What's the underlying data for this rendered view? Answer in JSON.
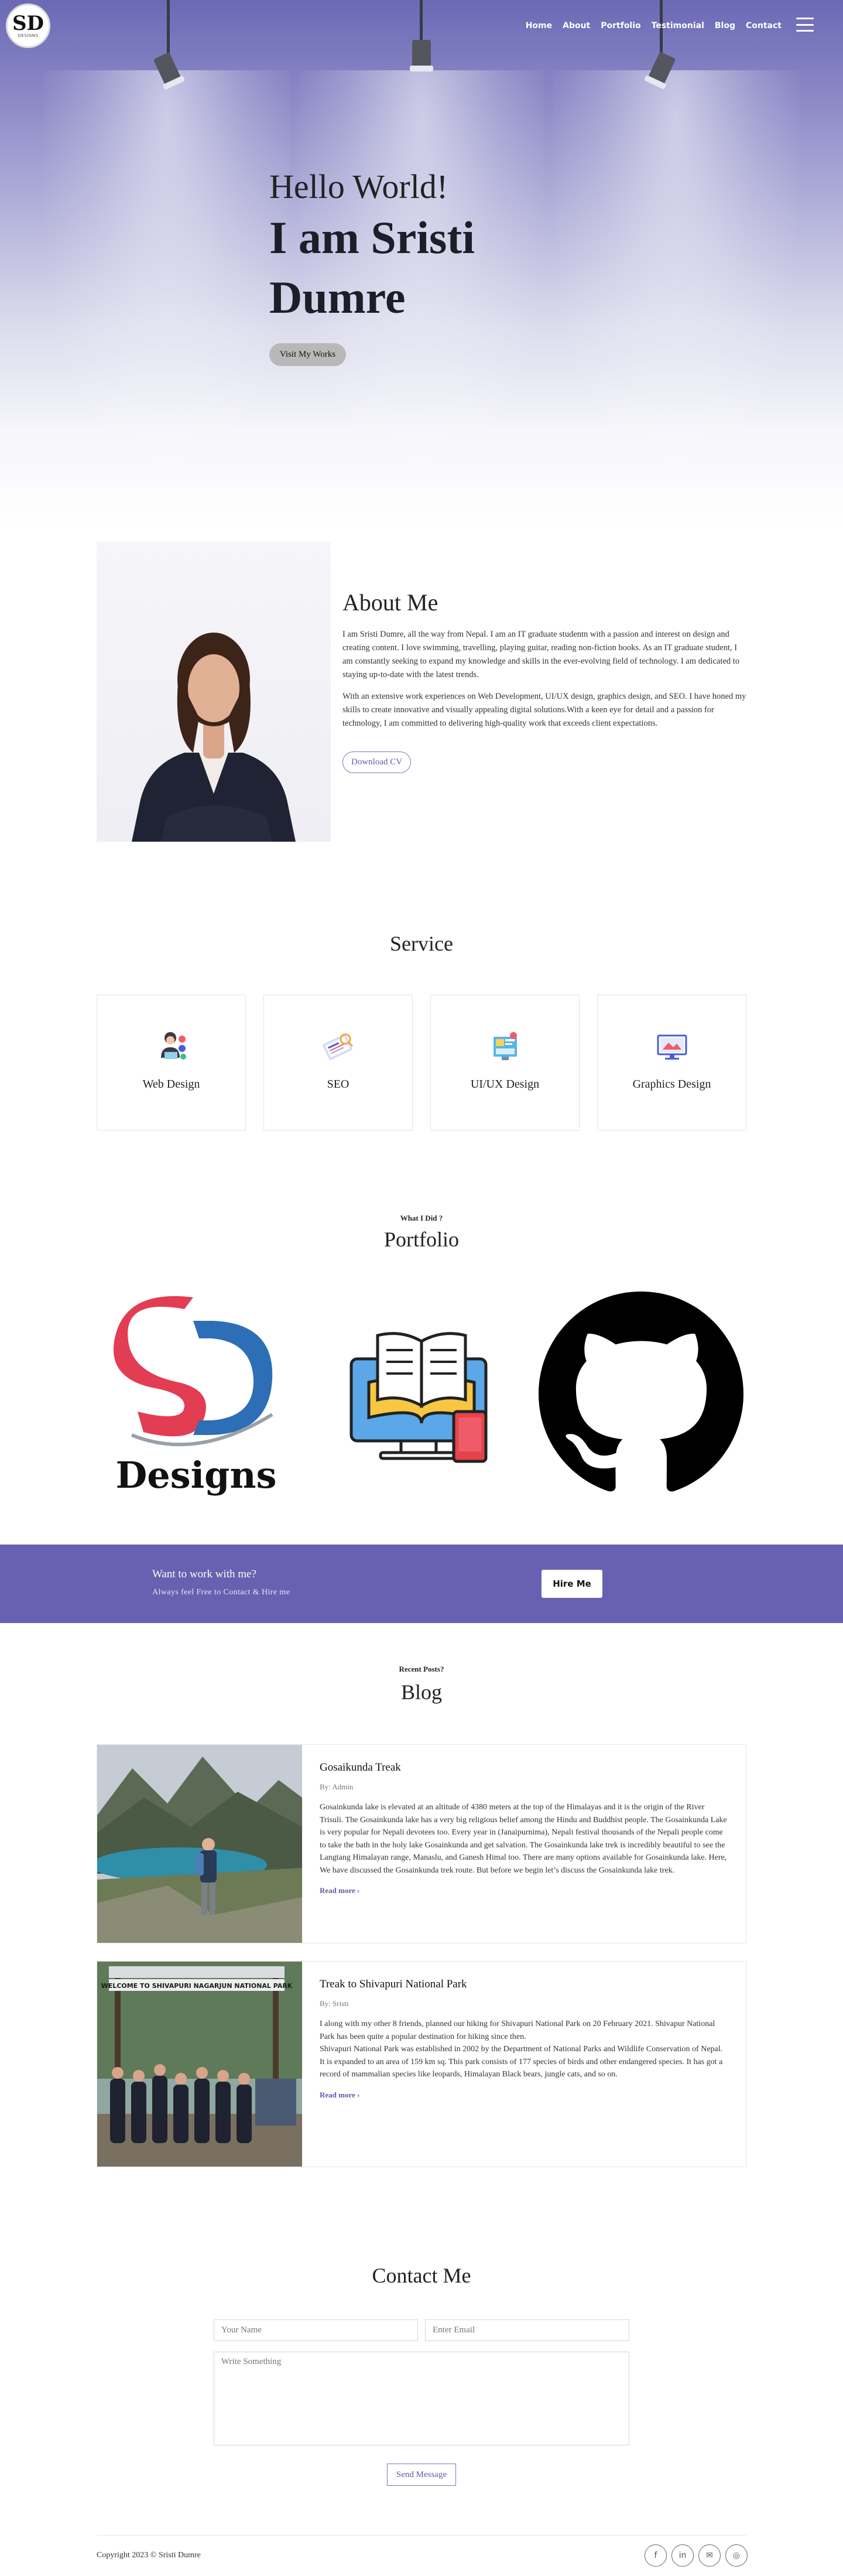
{
  "header": {
    "logo_main": "SD",
    "logo_sub": "DESIGNS",
    "nav": [
      "Home",
      "About",
      "Portfolio",
      "Testimonial",
      "Blog",
      "Contact"
    ]
  },
  "hero": {
    "greeting": "Hello World!",
    "name_line1": "I am Sristi",
    "name_line2": "Dumre",
    "button": "Visit My Works"
  },
  "about": {
    "title": "About Me",
    "paragraphs": [
      "I am Sristi Dumre, all the way from Nepal. I am an IT graduate studentn with a passion and interest on design and creating content. I love swimming, travelling, playing guitar, reading non-fiction books. As an IT graduate student, I am constantly seeking to expand my knowledge and skills in the ever-evolving field of technology. I am dedicated to staying up-to-date with the latest trends.",
      "With an extensive work experiences on Web Development, UI/UX design, graphics design, and SEO. I have honed my skills to create innovative and visually appealing digital solutions.With a keen eye for detail and a passion for technology, I am committed to delivering high-quality work that exceeds client expectations."
    ],
    "button": "Download CV"
  },
  "service": {
    "title": "Service",
    "items": [
      "Web Design",
      "SEO",
      "UI/UX Design",
      "Graphics Design"
    ]
  },
  "portfolio": {
    "eyebrow": "What I Did ?",
    "title": "Portfolio",
    "logo_text": "Designs"
  },
  "hire": {
    "title": "Want to work with me?",
    "subtitle": "Always feel Free to Contact & Hire me",
    "button": "Hire Me"
  },
  "blog": {
    "eyebrow": "Recent Posts?",
    "title": "Blog",
    "posts": [
      {
        "title": "Gosaikunda Treak",
        "author": "By: Admin",
        "body": "Gosainkunda lake is elevated at an altitude of 4380 meters at the top of the Himalayas and it is the origin of the River Trisuli. The Gosainkunda lake has a very big religious belief among the Hindu and Buddhist people. The Gosainkunda Lake is very popular for Nepali devotees too. Every year in (Janaipurnima), Nepali festival thousands of the Nepali people come to take the bath in the holy lake Gosainkunda and get salvation. The Gosainkunda lake trek is incredibly beautiful to see the Langtang Himalayan range, Manaslu, and Ganesh Himal too. There are many options available for Gosainkunda lake. Here, We have discussed the Gosainkunda trek route. But before we begin let’s discuss the Gosainkunda lake trek.",
        "read_more": "Read more"
      },
      {
        "title": "Treak to Shivapuri National Park",
        "author": "By: Sristi",
        "body1": "I along with my other 8 friends, planned our hiking for Shivapuri National Park on 20 February 2021. Shivapur National Park has been quite a popular destination for hiking since then.",
        "body2": "Shivapuri National Park was established in 2002 by the Department of National Parks and Wildlife Conservation of Nepal. It is expanded to an area of 159 km sq. This park consists of 177 species of birds and other endangered species. It has got a record of mammalian species like leopards, Himalayan Black bears, jungle cats, and so on.",
        "sign": "WELCOME TO SHIVAPURI NAGARJUN NATIONAL PARK",
        "read_more": "Read more"
      }
    ]
  },
  "contact": {
    "title": "Contact Me",
    "name_placeholder": "Your Name",
    "email_placeholder": "Enter Email",
    "message_placeholder": "Write Something",
    "button": "Send Message"
  },
  "footer": {
    "copyright": "Copyright 2023 © Sristi Dumre",
    "socials": [
      "f",
      "in",
      "✉",
      "◎"
    ]
  },
  "colors": {
    "accent": "#6661b0",
    "hero_top": "#6b69b5"
  }
}
